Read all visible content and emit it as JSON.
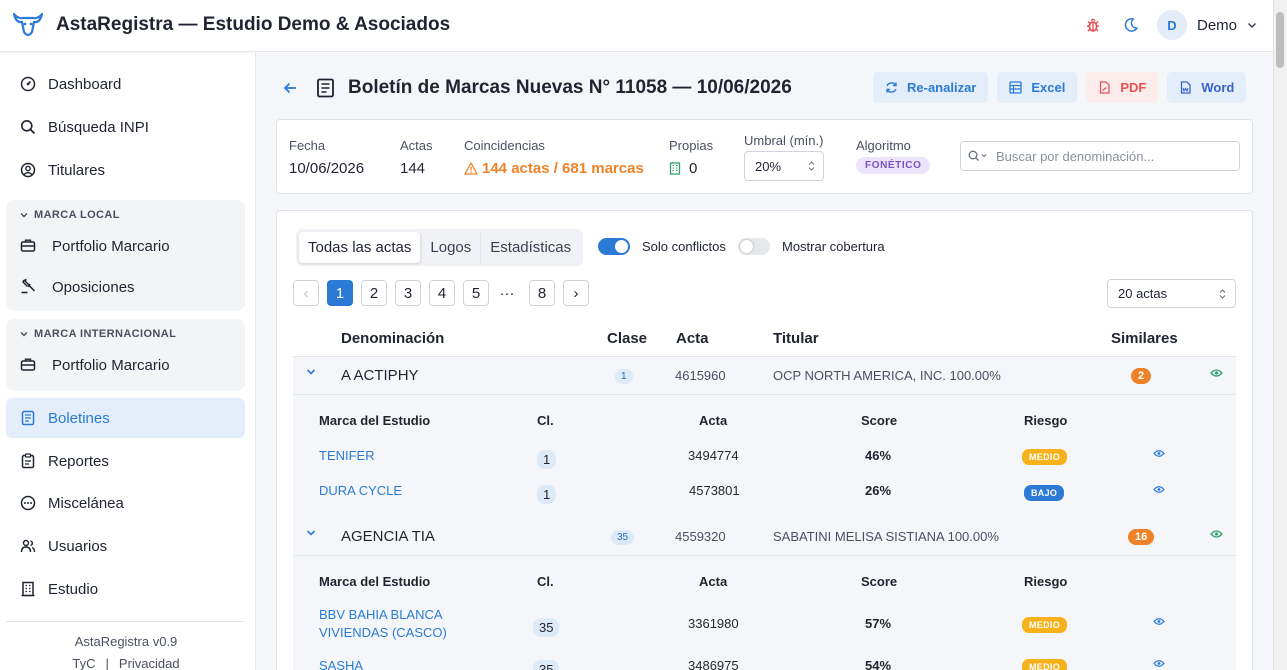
{
  "app": {
    "title": "AstaRegistra — Estudio Demo & Asociados"
  },
  "user": {
    "initial": "D",
    "name": "Demo"
  },
  "sidebar": {
    "items": [
      {
        "label": "Dashboard"
      },
      {
        "label": "Búsqueda INPI"
      },
      {
        "label": "Titulares"
      },
      {
        "label": "Boletines"
      },
      {
        "label": "Reportes"
      },
      {
        "label": "Miscelánea"
      },
      {
        "label": "Usuarios"
      },
      {
        "label": "Estudio"
      }
    ],
    "groups": [
      {
        "title": "MARCA LOCAL",
        "items": [
          {
            "label": "Portfolio Marcario"
          },
          {
            "label": "Oposiciones"
          }
        ]
      },
      {
        "title": "MARCA INTERNACIONAL",
        "items": [
          {
            "label": "Portfolio Marcario"
          }
        ]
      }
    ],
    "version": "AstaRegistra v0.9",
    "links": [
      "TyC",
      "|",
      "Privacidad"
    ]
  },
  "page": {
    "title": "Boletín de Marcas Nuevas N° 11058 — 10/06/2026",
    "actions": {
      "reanalyze": "Re-analizar",
      "excel": "Excel",
      "pdf": "PDF",
      "word": "Word"
    }
  },
  "stats": {
    "fecha": {
      "label": "Fecha",
      "value": "10/06/2026"
    },
    "actas": {
      "label": "Actas",
      "value": "144"
    },
    "coincidencias": {
      "label": "Coincidencias",
      "value": "144 actas / 681 marcas"
    },
    "propias": {
      "label": "Propias",
      "value": "0"
    },
    "umbral": {
      "label": "Umbral (mín.)",
      "value": "20%"
    },
    "algoritmo": {
      "label": "Algoritmo",
      "value": "FONÉTICO"
    },
    "search_placeholder": "Buscar por denominación..."
  },
  "tabs": [
    {
      "label": "Todas las actas"
    },
    {
      "label": "Logos"
    },
    {
      "label": "Estadísticas"
    }
  ],
  "toggles": {
    "solo_conflictos": "Solo conflictos",
    "mostrar_cobertura": "Mostrar cobertura"
  },
  "pagination": {
    "prev": "‹",
    "pages": [
      "1",
      "2",
      "3",
      "4",
      "5"
    ],
    "ellipsis": "···",
    "last": "8",
    "next": "›",
    "per_page": "20 actas"
  },
  "table": {
    "headers": {
      "denominacion": "Denominación",
      "clase": "Clase",
      "acta": "Acta",
      "titular": "Titular",
      "similares": "Similares"
    },
    "sub_headers": {
      "marca": "Marca del Estudio",
      "cl": "Cl.",
      "acta": "Acta",
      "score": "Score",
      "riesgo": "Riesgo"
    },
    "rows": [
      {
        "denominacion": "A ACTIPHY",
        "clase": "1",
        "acta": "4615960",
        "titular": "OCP NORTH AMERICA, INC. 100.00%",
        "similares": "2",
        "matches": [
          {
            "marca": "TENIFER",
            "cl": "1",
            "acta": "3494774",
            "score": "46%",
            "riesgo": "MEDIO"
          },
          {
            "marca": "DURA CYCLE",
            "cl": "1",
            "acta": "4573801",
            "score": "26%",
            "riesgo": "BAJO"
          }
        ]
      },
      {
        "denominacion": "AGENCIA TIA",
        "clase": "35",
        "acta": "4559320",
        "titular": "SABATINI MELISA SISTIANA 100.00%",
        "similares": "16",
        "matches": [
          {
            "marca": "BBV BAHIA BLANCA VIVIENDAS (CASCO)",
            "cl": "35",
            "acta": "3361980",
            "score": "57%",
            "riesgo": "MEDIO"
          },
          {
            "marca": "SASHA",
            "cl": "35",
            "acta": "3486975",
            "score": "54%",
            "riesgo": "MEDIO"
          }
        ]
      }
    ]
  },
  "colors": {
    "accent": "#2b7bd6",
    "warning": "#ee8228",
    "danger": "#e25353",
    "medio": "#f5b21a",
    "bajo": "#2b7bd6"
  },
  "icons": [
    "bull-logo-icon",
    "bug-icon",
    "moon-icon",
    "chevron-down-icon",
    "dashboard-icon",
    "search-icon",
    "user-circle-icon",
    "briefcase-icon",
    "gavel-icon",
    "newspaper-icon",
    "clipboard-icon",
    "dots-circle-icon",
    "users-icon",
    "building-icon",
    "arrow-left-icon",
    "document-icon",
    "refresh-icon",
    "spreadsheet-icon",
    "pdf-file-icon",
    "word-file-icon",
    "warning-triangle-icon",
    "building-green-icon",
    "eye-icon"
  ]
}
